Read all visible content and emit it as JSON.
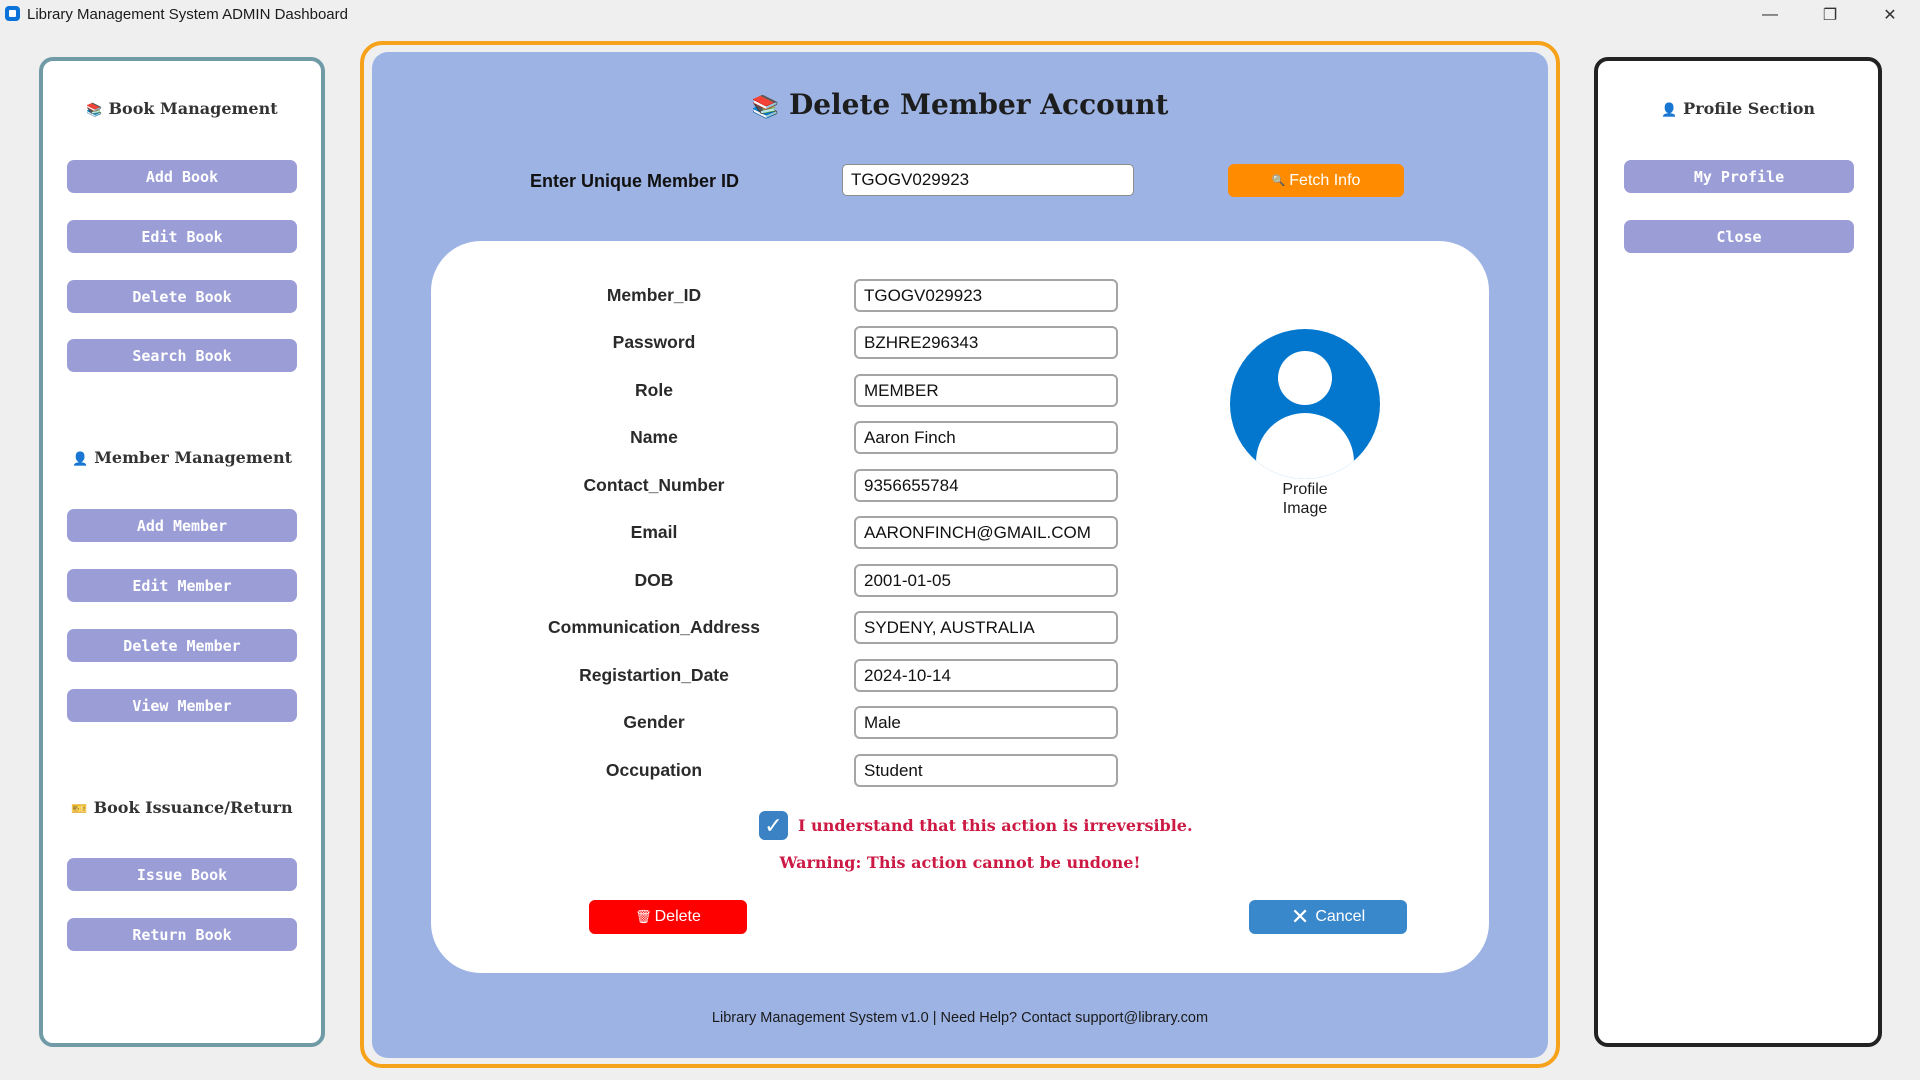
{
  "window": {
    "title": "Library Management System ADMIN Dashboard",
    "controls": {
      "minimize": "—",
      "restore": "❐",
      "close": "✕"
    }
  },
  "sidebar_left": {
    "book_management": {
      "heading": "Book Management",
      "icon": "book-icon",
      "buttons": [
        "Add Book",
        "Edit Book",
        "Delete Book",
        "Search Book"
      ]
    },
    "member_management": {
      "heading": "Member Management",
      "icon": "person-icon",
      "buttons": [
        "Add Member",
        "Edit Member",
        "Delete Member",
        "View Member"
      ]
    },
    "issuance": {
      "heading": "Book Issuance/Return",
      "icon": "ticket-icon",
      "buttons": [
        "Issue Book",
        "Return Book"
      ]
    }
  },
  "sidebar_right": {
    "heading": "Profile Section",
    "icon": "person-icon",
    "buttons": [
      "My Profile",
      "Close"
    ]
  },
  "main": {
    "title": "Delete Member Account",
    "title_icon": "books-icon",
    "uid_label": "Enter Unique Member ID",
    "uid_value": "TGOGV029923",
    "fetch_label": "Fetch Info",
    "fetch_icon": "magnifier-icon",
    "fields": [
      {
        "label": "Member_ID",
        "value": "TGOGV029923"
      },
      {
        "label": "Password",
        "value": "BZHRE296343"
      },
      {
        "label": "Role",
        "value": "MEMBER"
      },
      {
        "label": "Name",
        "value": "Aaron Finch"
      },
      {
        "label": "Contact_Number",
        "value": "9356655784"
      },
      {
        "label": "Email",
        "value": "AARONFINCH@GMAIL.COM"
      },
      {
        "label": "DOB",
        "value": "2001-01-05"
      },
      {
        "label": "Communication_Address",
        "value": "SYDENY, AUSTRALIA"
      },
      {
        "label": "Registartion_Date",
        "value": "2024-10-14"
      },
      {
        "label": "Gender",
        "value": "Male"
      },
      {
        "label": "Occupation",
        "value": "Student"
      }
    ],
    "profile_label": "Profile\nImage",
    "confirm_checked": true,
    "confirm_text": "I understand that this action is irreversible.",
    "warning_text": "Warning: This action cannot be undone!",
    "delete_label": "Delete",
    "delete_icon": "trash-icon",
    "cancel_label": "Cancel",
    "cancel_icon": "x-icon",
    "footer": "Library Management System v1.0 | Need Help? Contact support@library.com"
  },
  "colors": {
    "main_bg": "#9db3e4",
    "accent_border": "#f6a21a",
    "side_button": "#9a9dd6",
    "fetch": "#ff8c00",
    "delete": "#ff0000",
    "cancel": "#3a88cc",
    "warning": "#cc1a44"
  }
}
